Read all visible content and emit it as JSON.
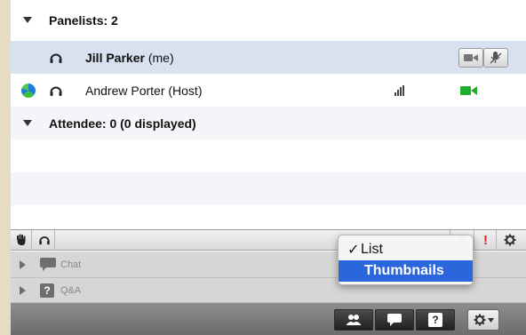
{
  "panelists_header": "Panelists: 2",
  "panelists": [
    {
      "name": "Jill Parker",
      "suffix": "(me)"
    },
    {
      "name": "Andrew Porter (Host)"
    }
  ],
  "attendee_header": "Attendee: 0 (0 displayed)",
  "sections": {
    "chat": "Chat",
    "qa": "Q&A"
  },
  "view_menu": {
    "items": [
      {
        "label": "List",
        "checked": true
      },
      {
        "label": "Thumbnails",
        "highlighted": true
      }
    ]
  },
  "alert_mark": "!",
  "qa_icon_glyph": "?",
  "icons": [
    "expand-triangle-icon",
    "headset-icon",
    "globe-icon",
    "signal-bars-icon",
    "video-camera-icon",
    "mute-microphone-icon",
    "raise-hand-icon",
    "alert-icon",
    "gear-icon",
    "chat-bubble-icon",
    "question-icon",
    "people-icon",
    "dropdown-arrow-icon"
  ],
  "colors": {
    "selected_row": "#d8e1ef",
    "menu_highlight": "#2c66dc",
    "video_on": "#1fae2d",
    "alert": "#d9211e"
  }
}
